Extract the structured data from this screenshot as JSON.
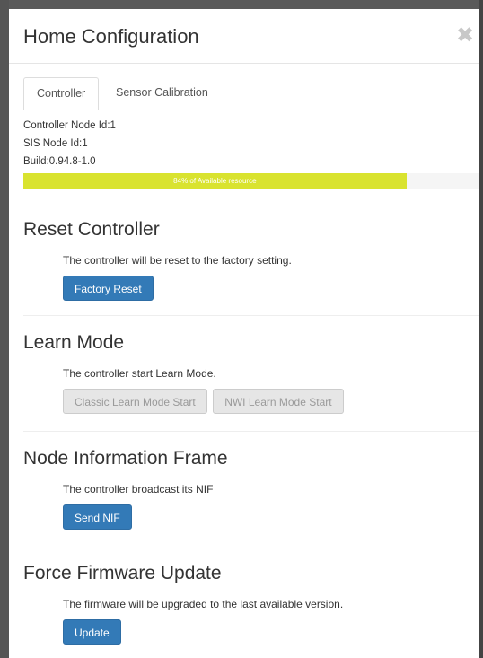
{
  "modal": {
    "title": "Home Configuration",
    "close_symbol": "✖"
  },
  "tabs": [
    {
      "label": "Controller",
      "active": true
    },
    {
      "label": "Sensor Calibration",
      "active": false
    }
  ],
  "info": {
    "controller_node": "Controller Node Id:1",
    "sis_node": "SIS Node Id:1",
    "build": "Build:0.94.8-1.0"
  },
  "resource": {
    "percent": 84,
    "label": "84% of Available resource",
    "color": "#d9e32f"
  },
  "sections": {
    "reset": {
      "title": "Reset Controller",
      "description": "The controller will be reset to the factory setting.",
      "button": "Factory Reset"
    },
    "learn": {
      "title": "Learn Mode",
      "description": "The controller start Learn Mode.",
      "button_classic": "Classic Learn Mode Start",
      "button_nwi": "NWI Learn Mode Start"
    },
    "nif": {
      "title": "Node Information Frame",
      "description": "The controller broadcast its NIF",
      "button": "Send NIF"
    },
    "firmware": {
      "title": "Force Firmware Update",
      "description": "The firmware will be upgraded to the last available version.",
      "button": "Update"
    }
  },
  "colors": {
    "primary_button": "#337ab7",
    "disabled_button": "#e6e6e6"
  }
}
